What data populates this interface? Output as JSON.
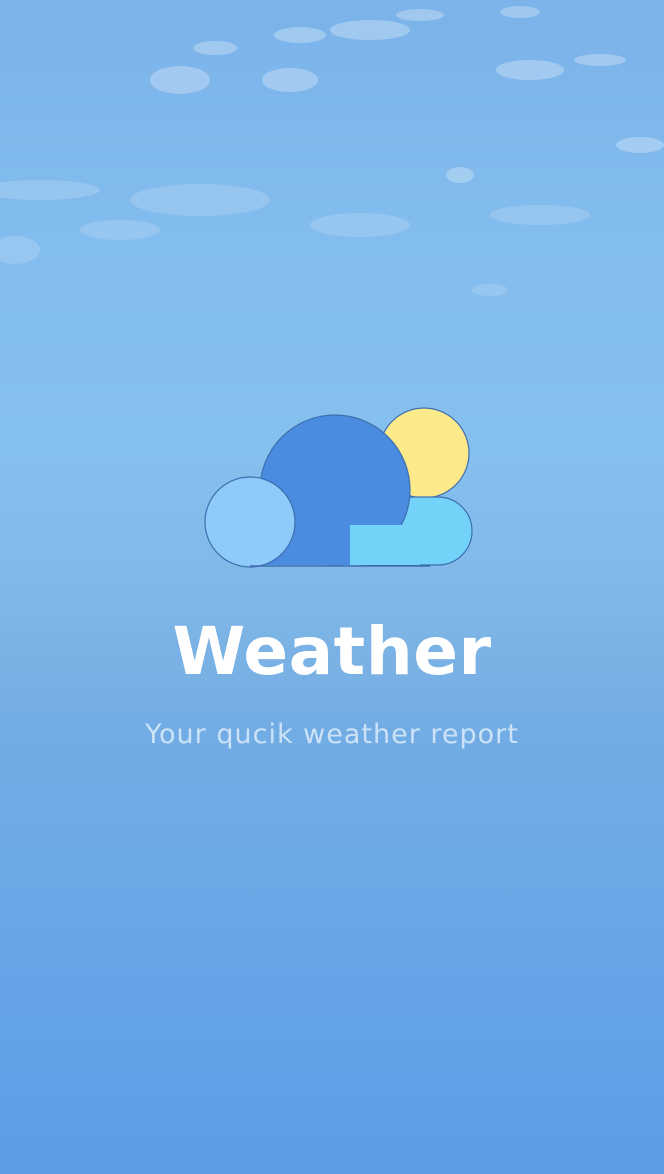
{
  "app": {
    "title": "Weather",
    "subtitle": "Your qucik weather report"
  },
  "logo": {
    "icon": "partly-cloudy-icon",
    "colors": {
      "big_cloud": "#4a8ce0",
      "small_cloud": "#8ecbfa",
      "pill_cloud": "#72d2f8",
      "sun": "#fbe98a",
      "outline": "#3d6fb0"
    }
  },
  "background": {
    "top_color": "#7bb3ea",
    "bottom_color": "#5b9de5"
  }
}
